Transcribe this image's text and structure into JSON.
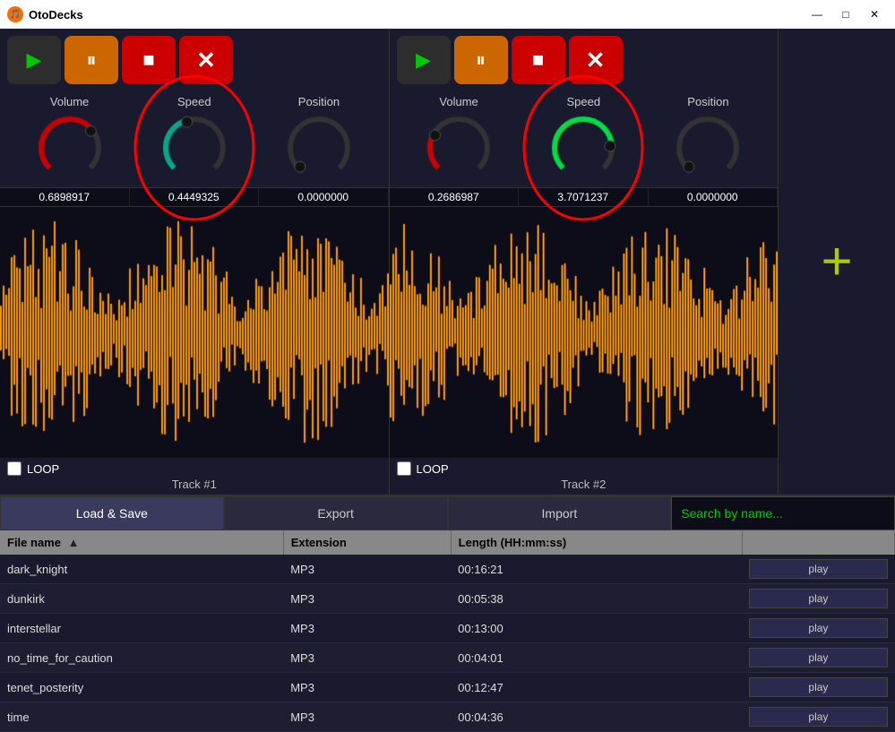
{
  "app": {
    "title": "OtoDecks",
    "icon": "🎵"
  },
  "titlebar": {
    "minimize": "—",
    "maximize": "□",
    "close": "✕"
  },
  "deck1": {
    "transport": {
      "play": "▶",
      "pause": "⏸",
      "stop": "■",
      "close": "✕"
    },
    "knobs": {
      "volume_label": "Volume",
      "speed_label": "Speed",
      "position_label": "Position",
      "volume_value": "0.6898917",
      "speed_value": "0.4449325",
      "position_value": "0.0000000"
    },
    "loop_label": "LOOP",
    "track_label": "Track #1"
  },
  "deck2": {
    "transport": {
      "play": "▶",
      "pause": "⏸",
      "stop": "■",
      "close": "✕"
    },
    "knobs": {
      "volume_label": "Volume",
      "speed_label": "Speed",
      "position_label": "Position",
      "volume_value": "0.2686987",
      "speed_value": "3.7071237",
      "position_value": "0.0000000"
    },
    "loop_label": "LOOP",
    "track_label": "Track #2"
  },
  "add_button": "+",
  "bottom": {
    "tabs": {
      "load_save": "Load & Save",
      "export": "Export",
      "import": "Import"
    },
    "search_placeholder": "Search by name...",
    "table": {
      "headers": [
        "File name",
        "Extension",
        "Length (HH:mm:ss)",
        ""
      ],
      "rows": [
        {
          "name": "dark_knight",
          "ext": "MP3",
          "length": "00:16:21"
        },
        {
          "name": "dunkirk",
          "ext": "MP3",
          "length": "00:05:38"
        },
        {
          "name": "interstellar",
          "ext": "MP3",
          "length": "00:13:00"
        },
        {
          "name": "no_time_for_caution",
          "ext": "MP3",
          "length": "00:04:01"
        },
        {
          "name": "tenet_posterity",
          "ext": "MP3",
          "length": "00:12:47"
        },
        {
          "name": "time",
          "ext": "MP3",
          "length": "00:04:36"
        }
      ],
      "play_label": "play"
    }
  }
}
